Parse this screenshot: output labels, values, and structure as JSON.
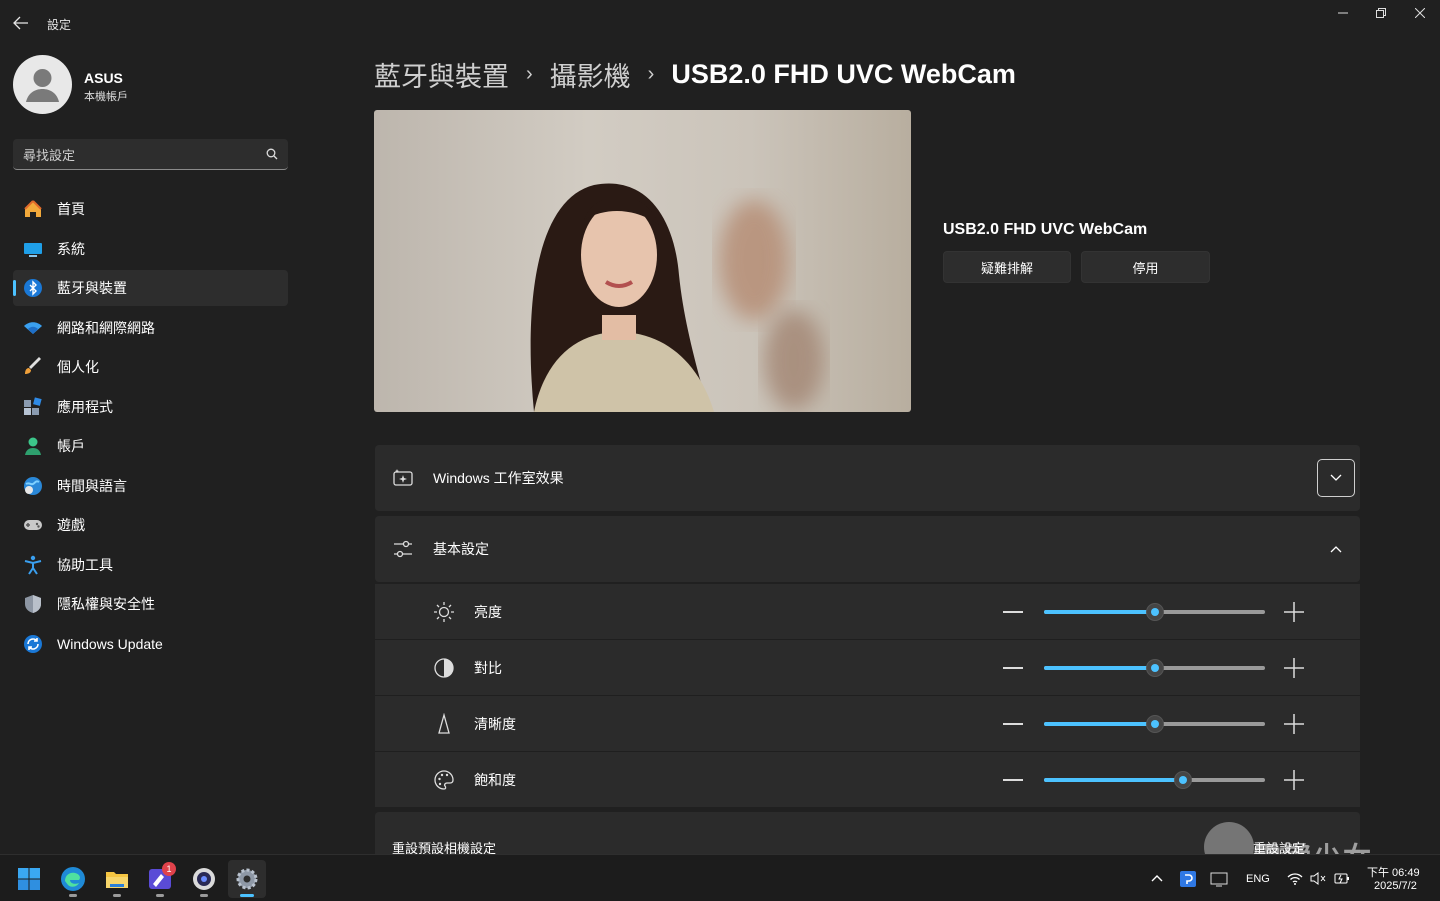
{
  "titlebar": {
    "title": "設定"
  },
  "user": {
    "name": "ASUS",
    "account_type": "本機帳戶"
  },
  "search": {
    "placeholder": "尋找設定"
  },
  "nav": {
    "items": [
      {
        "label": "首頁",
        "icon": "home-icon"
      },
      {
        "label": "系統",
        "icon": "system-icon"
      },
      {
        "label": "藍牙與裝置",
        "icon": "bluetooth-icon",
        "active": true
      },
      {
        "label": "網路和網際網路",
        "icon": "wifi-icon"
      },
      {
        "label": "個人化",
        "icon": "brush-icon"
      },
      {
        "label": "應用程式",
        "icon": "apps-icon"
      },
      {
        "label": "帳戶",
        "icon": "account-icon"
      },
      {
        "label": "時間與語言",
        "icon": "globe-icon"
      },
      {
        "label": "遊戲",
        "icon": "gamepad-icon"
      },
      {
        "label": "協助工具",
        "icon": "accessibility-icon"
      },
      {
        "label": "隱私權與安全性",
        "icon": "shield-icon"
      },
      {
        "label": "Windows Update",
        "icon": "update-icon"
      }
    ]
  },
  "breadcrumb": {
    "level1": "藍牙與裝置",
    "level2": "攝影機",
    "current": "USB2.0 FHD UVC WebCam"
  },
  "camera": {
    "name": "USB2.0 FHD UVC WebCam",
    "troubleshoot_label": "疑難排解",
    "disable_label": "停用"
  },
  "studio_effects": {
    "label": "Windows 工作室效果"
  },
  "basic_settings": {
    "label": "基本設定",
    "sliders": [
      {
        "label": "亮度",
        "icon": "brightness-icon",
        "value": 50
      },
      {
        "label": "對比",
        "icon": "contrast-icon",
        "value": 50
      },
      {
        "label": "清晰度",
        "icon": "sharpness-icon",
        "value": 50
      },
      {
        "label": "飽和度",
        "icon": "palette-icon",
        "value": 63
      }
    ]
  },
  "reset": {
    "label": "重設預設相機設定",
    "button_label": "重設設定"
  },
  "taskbar": {
    "notification_count": "1",
    "language": "ENG",
    "time": "下午 06:49",
    "date": "2025/7/2"
  },
  "watermark": {
    "text": "電獺少女"
  },
  "colors": {
    "accent": "#4cc2ff",
    "background": "#202020",
    "card": "#2b2b2b"
  }
}
